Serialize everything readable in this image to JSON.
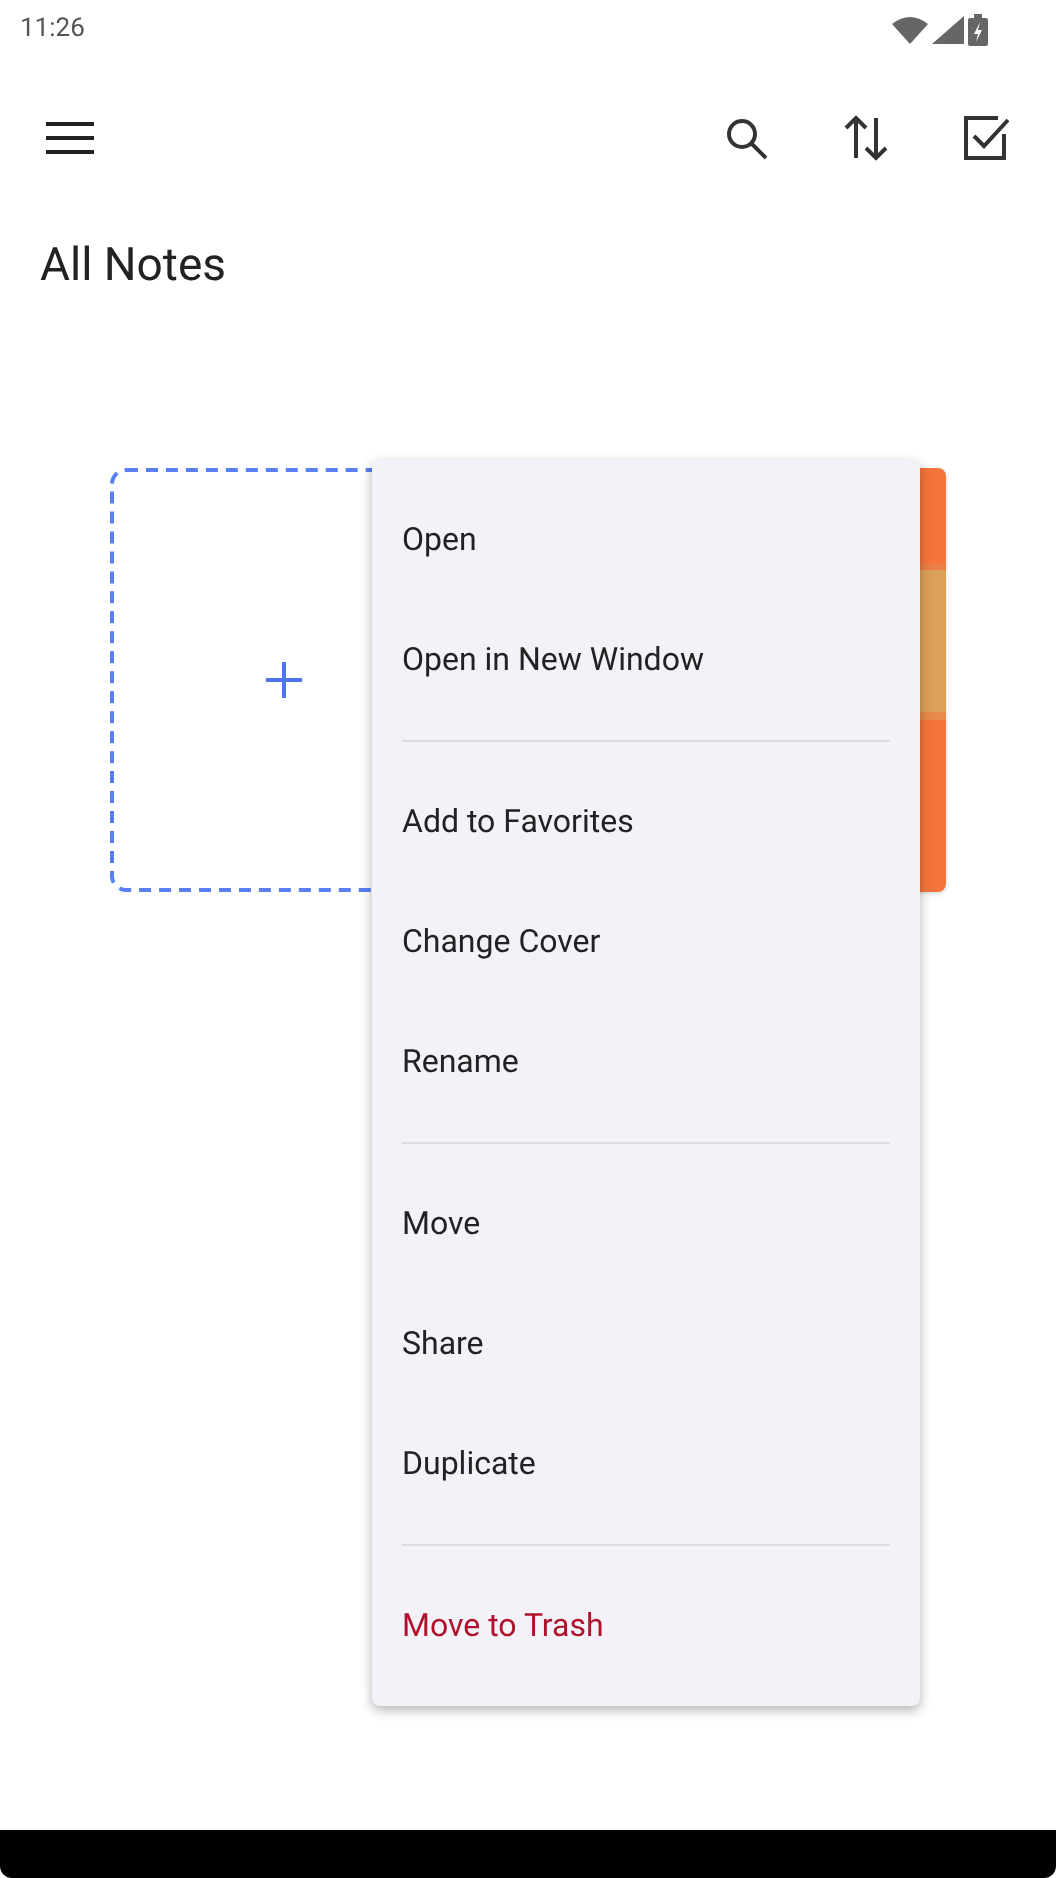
{
  "status_bar": {
    "time": "11:26"
  },
  "page": {
    "title": "All Notes"
  },
  "notes": [
    {
      "kind": "new"
    },
    {
      "kind": "note"
    }
  ],
  "menu": {
    "groups": [
      [
        {
          "label": "Open",
          "kind": "normal"
        },
        {
          "label": "Open in New Window",
          "kind": "normal"
        }
      ],
      [
        {
          "label": "Add to Favorites",
          "kind": "normal"
        },
        {
          "label": "Change Cover",
          "kind": "normal"
        },
        {
          "label": "Rename",
          "kind": "normal"
        }
      ],
      [
        {
          "label": "Move",
          "kind": "normal"
        },
        {
          "label": "Share",
          "kind": "normal"
        },
        {
          "label": "Duplicate",
          "kind": "normal"
        }
      ],
      [
        {
          "label": "Move to Trash",
          "kind": "danger"
        }
      ]
    ]
  }
}
